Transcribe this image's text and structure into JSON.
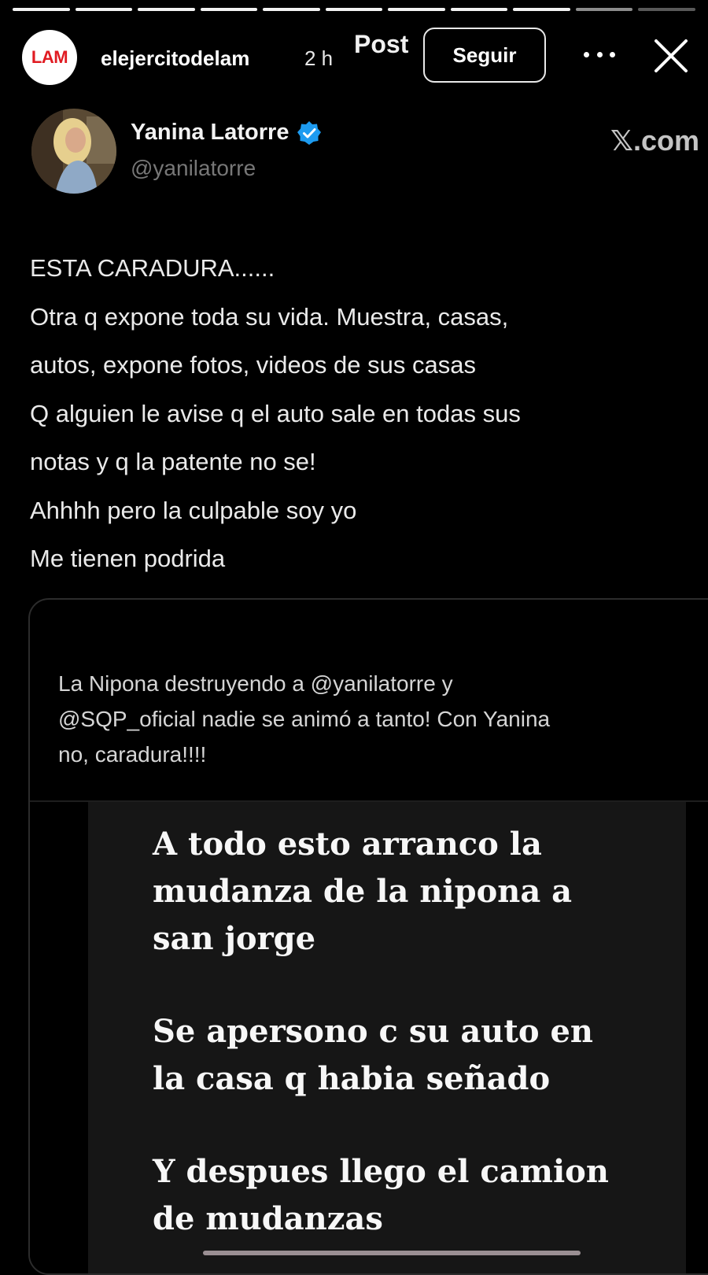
{
  "story": {
    "progress": {
      "total_segments": 11,
      "completed_segments": 9,
      "current_segment_index": 9
    },
    "account": {
      "logo_text": "LAM",
      "username": "elejercitodelam",
      "time_ago": "2 h"
    },
    "post_tag": "Post",
    "follow_button_label": "Seguir"
  },
  "tweet": {
    "author_name": "Yanina Latorre",
    "handle": "@yanilatorre",
    "source_brand": "𝕏.com",
    "body_lines": [
      "ESTA CARADURA......",
      "Otra  q expone toda su vida. Muestra, casas,",
      "autos, expone fotos, videos de sus casas",
      "Q alguien le avise q el auto sale en todas sus",
      "notas y q la patente no se!",
      "Ahhhh pero la culpable soy yo",
      "Me tienen podrida"
    ]
  },
  "quoted": {
    "text_lines": [
      "La Nipona destruyendo a @yanilatorre y",
      "@SQP_oficial nadie se animó a tanto! Con Yanina",
      "no, caradura!!!!"
    ],
    "media_paragraphs": [
      {
        "lines": [
          "A todo esto arranco la",
          "mudanza de la nipona a",
          "san jorge"
        ]
      },
      {
        "lines": [
          "Se apersono c su auto en",
          "la casa q habia señado"
        ]
      },
      {
        "lines": [
          "Y despues llego el camion",
          "de mudanzas"
        ]
      }
    ]
  },
  "colors": {
    "background": "#000000",
    "lam_red": "#e01b22",
    "verified_blue": "#1d9bf0",
    "handle_gray": "#777777"
  },
  "icons": [
    "more-options-icon",
    "close-icon",
    "verified-badge-icon"
  ]
}
